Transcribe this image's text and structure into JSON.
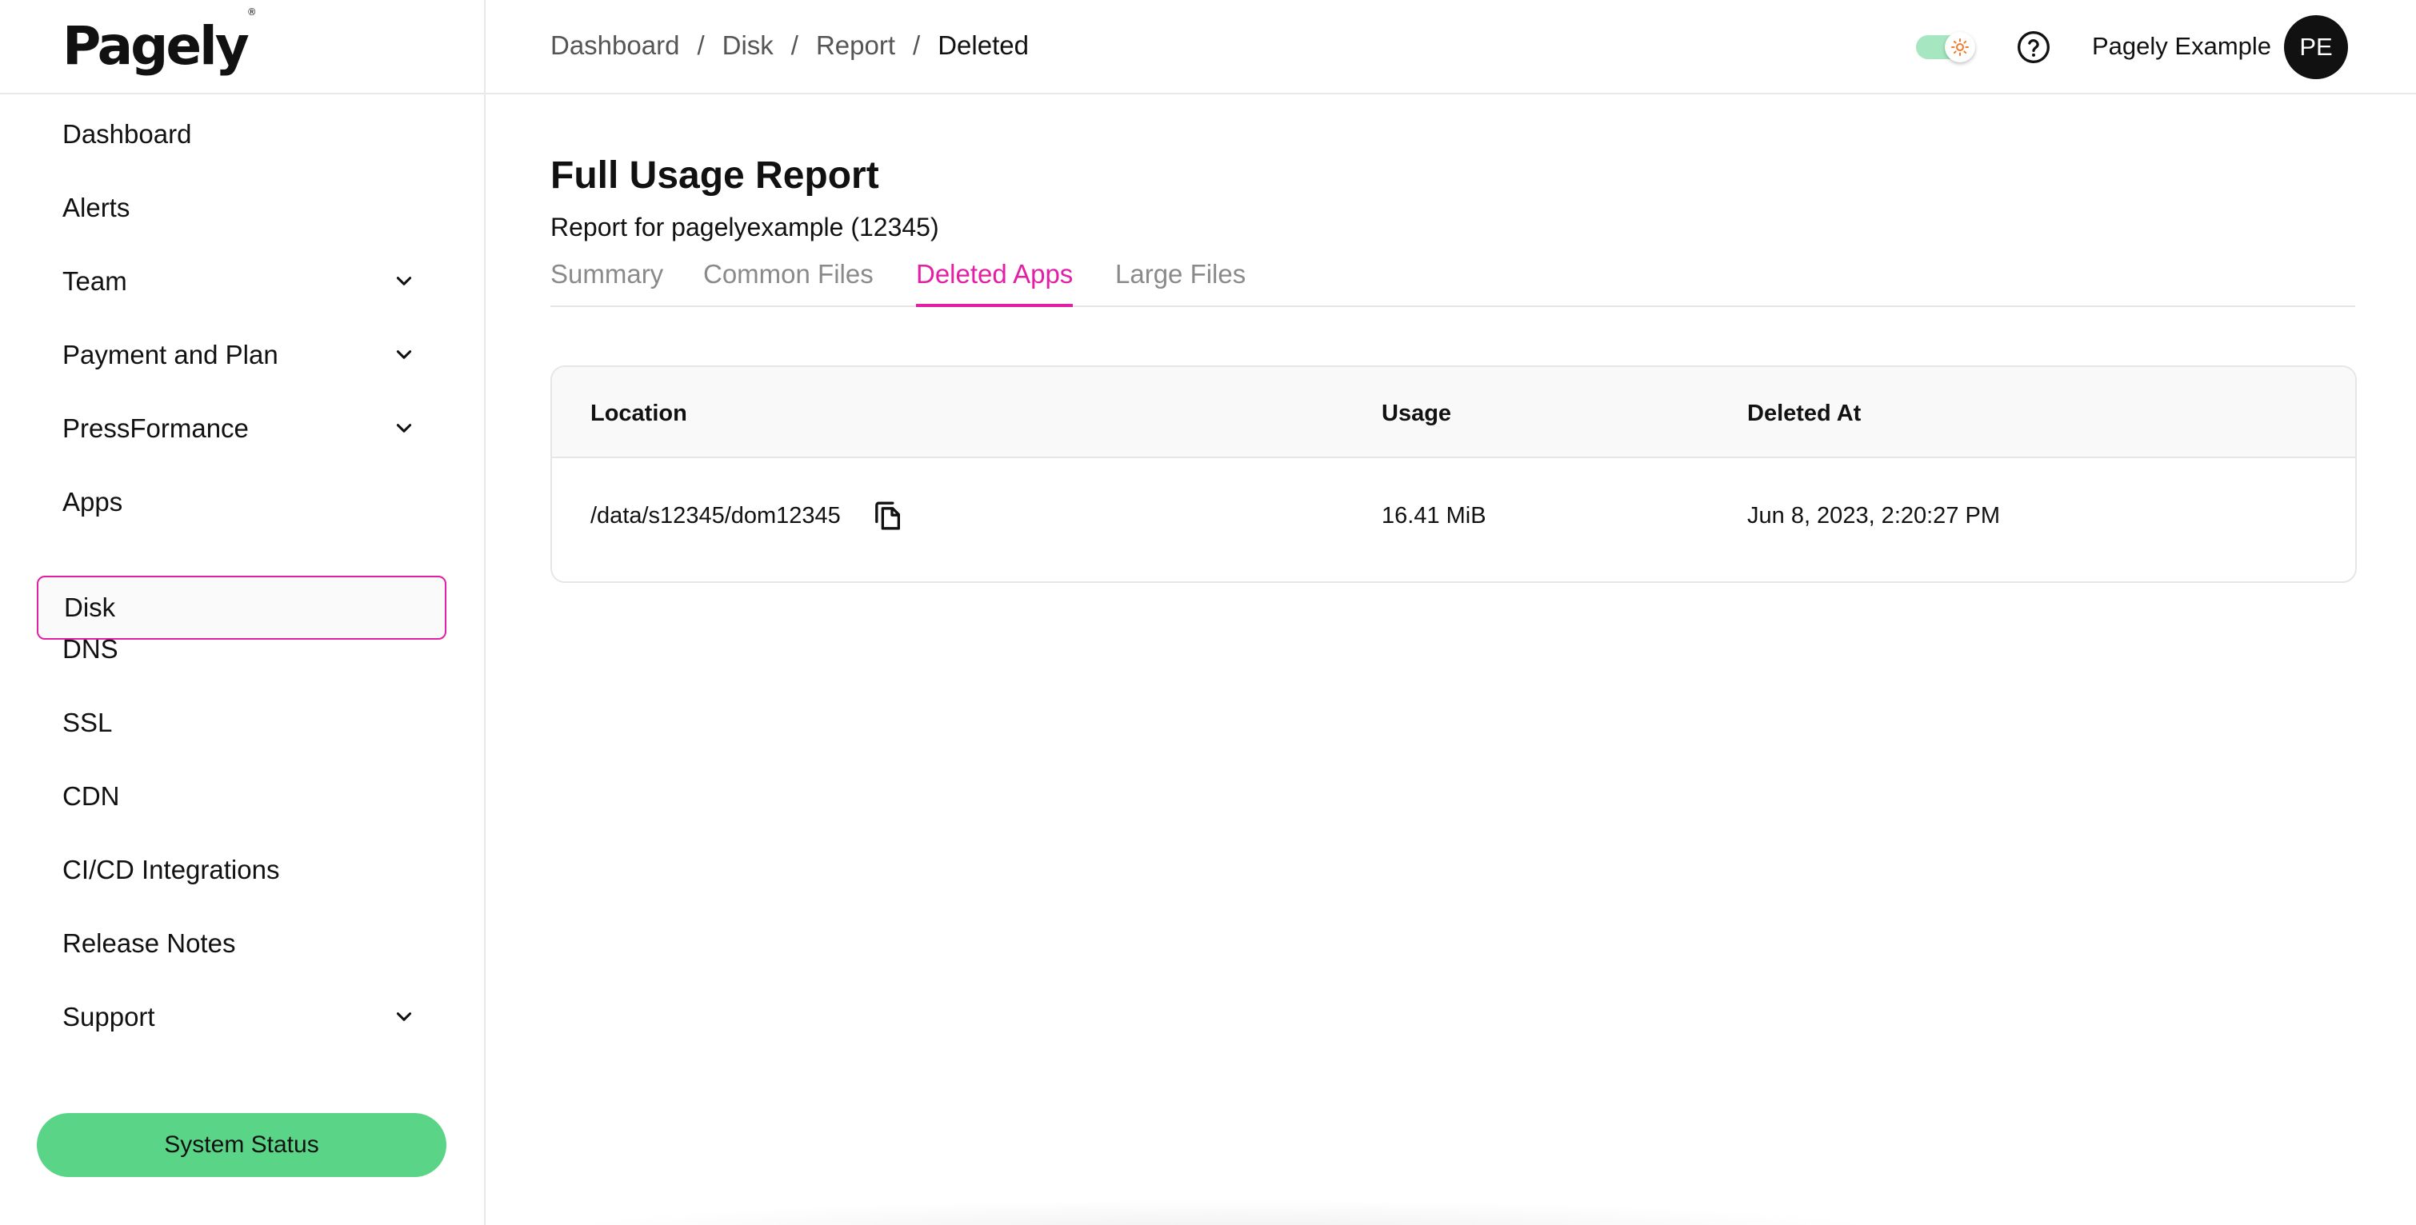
{
  "brand": {
    "logo_text": "Pagely",
    "logo_mark": "®"
  },
  "sidebar": {
    "items": [
      {
        "label": "Dashboard",
        "has_chevron": false
      },
      {
        "label": "Alerts",
        "has_chevron": false
      },
      {
        "label": "Team",
        "has_chevron": true
      },
      {
        "label": "Payment and Plan",
        "has_chevron": true
      },
      {
        "label": "PressFormance",
        "has_chevron": true
      },
      {
        "label": "Apps",
        "has_chevron": false
      },
      {
        "label": "Disk",
        "has_chevron": false,
        "active": true
      },
      {
        "label": "DNS",
        "has_chevron": false
      },
      {
        "label": "SSL",
        "has_chevron": false
      },
      {
        "label": "CDN",
        "has_chevron": false
      },
      {
        "label": "CI/CD Integrations",
        "has_chevron": false
      },
      {
        "label": "Release Notes",
        "has_chevron": false
      },
      {
        "label": "Support",
        "has_chevron": true
      }
    ],
    "system_status_label": "System Status"
  },
  "header": {
    "breadcrumb": [
      "Dashboard",
      "Disk",
      "Report",
      "Deleted"
    ],
    "breadcrumb_separator": "/",
    "user_name": "Pagely Example",
    "avatar_initials": "PE",
    "theme_toggle_on": true
  },
  "main": {
    "title": "Full Usage Report",
    "subtitle": "Report for pagelyexample (12345)",
    "tabs": [
      {
        "label": "Summary",
        "active": false
      },
      {
        "label": "Common Files",
        "active": false
      },
      {
        "label": "Deleted Apps",
        "active": true
      },
      {
        "label": "Large Files",
        "active": false
      }
    ],
    "table": {
      "columns": [
        "Location",
        "Usage",
        "Deleted At"
      ],
      "rows": [
        {
          "location": "/data/s12345/dom12345",
          "usage": "16.41 MiB",
          "deleted_at": "Jun 8, 2023, 2:20:27 PM"
        }
      ]
    }
  },
  "colors": {
    "accent": "#e21fa5",
    "status_green": "#5ad487",
    "toggle_track": "#a6e7c2",
    "toggle_sun": "#f07a2e",
    "text": "#111111",
    "muted": "#8a8a8a"
  }
}
